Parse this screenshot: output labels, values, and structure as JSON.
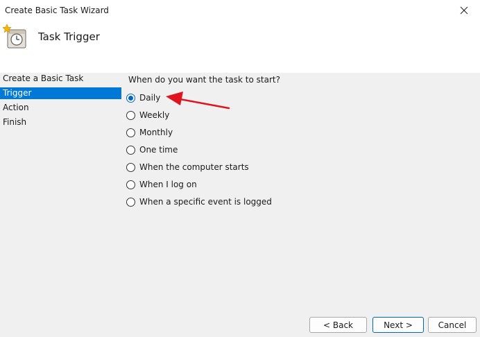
{
  "window": {
    "title": "Create Basic Task Wizard",
    "close_icon": "close-icon"
  },
  "header": {
    "title": "Task Trigger",
    "icon": "task-scheduler-icon"
  },
  "sidebar": {
    "items": [
      {
        "label": "Create a Basic Task",
        "selected": false
      },
      {
        "label": "Trigger",
        "selected": true
      },
      {
        "label": "Action",
        "selected": false
      },
      {
        "label": "Finish",
        "selected": false
      }
    ]
  },
  "main": {
    "question": "When do you want the task to start?",
    "options": [
      {
        "label": "Daily",
        "checked": true
      },
      {
        "label": "Weekly",
        "checked": false
      },
      {
        "label": "Monthly",
        "checked": false
      },
      {
        "label": "One time",
        "checked": false
      },
      {
        "label": "When the computer starts",
        "checked": false
      },
      {
        "label": "When I log on",
        "checked": false
      },
      {
        "label": "When a specific event is logged",
        "checked": false
      }
    ]
  },
  "footer": {
    "back_label": "< Back",
    "next_label": "Next >",
    "cancel_label": "Cancel"
  },
  "colors": {
    "accent": "#0078d7",
    "annotation_arrow": "#e0141e"
  }
}
